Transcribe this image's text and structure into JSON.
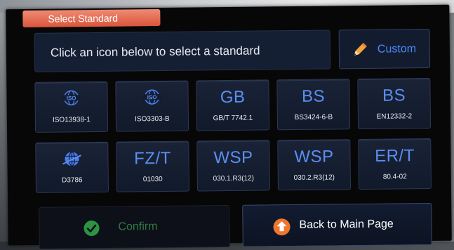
{
  "header": {
    "title": "Select Standard"
  },
  "prompt": {
    "text": "Click an icon below to select a standard"
  },
  "custom_button": {
    "label": "Custom",
    "icon": "pencil-icon"
  },
  "standards": [
    {
      "big": "",
      "icon": "iso-logo-icon",
      "code": "ISO13938-1"
    },
    {
      "big": "",
      "icon": "iso-logo-icon",
      "code": "ISO3303-B"
    },
    {
      "big": "GB",
      "code": "GB/T 7742.1"
    },
    {
      "big": "BS",
      "code": "BS3424-6-B"
    },
    {
      "big": "BS",
      "code": "EN12332-2"
    },
    {
      "big": "",
      "icon": "astm-globe-icon",
      "code": "D3786"
    },
    {
      "big": "FZ/T",
      "code": "01030"
    },
    {
      "big": "WSP",
      "code": "030.1.R3(12)"
    },
    {
      "big": "WSP",
      "code": "030.2.R3(12)"
    },
    {
      "big": "ER/T",
      "code": "80.4-02"
    }
  ],
  "confirm_button": {
    "label": "Confirm",
    "icon": "check-circle-icon",
    "enabled": false
  },
  "back_button": {
    "label": "Back to Main Page",
    "icon": "home-up-icon"
  },
  "colors": {
    "accent_blue": "#4a86ff",
    "title_tab": "#e66a50",
    "confirm_green": "#31a84b",
    "home_orange": "#f0762f"
  }
}
